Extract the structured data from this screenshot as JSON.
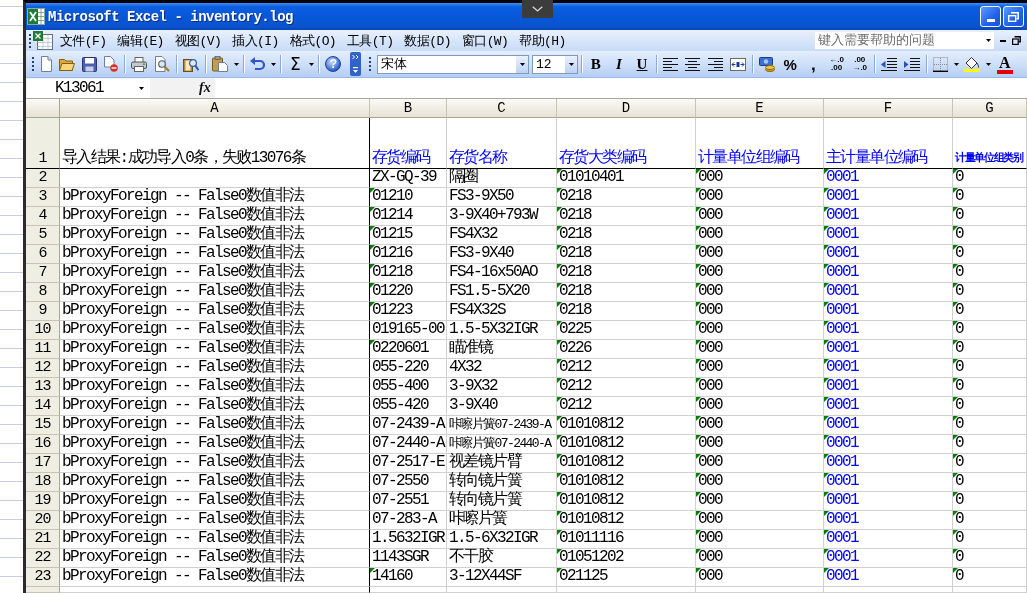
{
  "window": {
    "title": "Microsoft Excel - inventory.log"
  },
  "menu_bar": {
    "items": [
      "文件(F)",
      "编辑(E)",
      "视图(V)",
      "插入(I)",
      "格式(O)",
      "工具(T)",
      "数据(D)",
      "窗口(W)",
      "帮助(H)"
    ],
    "help_search": {
      "placeholder": "键入需要帮助的问题"
    }
  },
  "standard_toolbar": {
    "sum_button": "Σ",
    "help_button": "?"
  },
  "formatting_toolbar": {
    "font": "宋体",
    "font_size": "12",
    "style_buttons": [
      {
        "kind": "bold",
        "label": "B"
      },
      {
        "kind": "italic",
        "label": "I"
      },
      {
        "kind": "underline",
        "label": "U"
      }
    ],
    "percent_button": "%",
    "comma_button": ",",
    "increase_decimal": [
      "←.0",
      ".00"
    ],
    "decrease_decimal": [
      ".00",
      "→.0"
    ],
    "font_color_button": "A"
  },
  "formula_bar": {
    "name_box": "K13061",
    "function_button": "fx"
  },
  "sheet": {
    "columns": [
      "A",
      "B",
      "C",
      "D",
      "E",
      "F",
      "G"
    ],
    "rows": [
      {
        "number": "1",
        "cells": [
          {
            "text": "导入结果:成功导入0条，失败13076条",
            "error_mark": false
          },
          {
            "text": "存货编码",
            "error_mark": false,
            "color": "#0000ff"
          },
          {
            "text": "存货名称",
            "error_mark": false,
            "color": "#0000ff"
          },
          {
            "text": "存货大类编码",
            "error_mark": false,
            "color": "#0000ff"
          },
          {
            "text": "计量单位组编码",
            "error_mark": false,
            "color": "#0000ff"
          },
          {
            "text": "主计量单位编码",
            "error_mark": false,
            "color": "#0000ff"
          },
          {
            "text": "计量单位组类别",
            "error_mark": false,
            "color": "#0000ff"
          }
        ]
      },
      {
        "number": "2",
        "cells": [
          {
            "error_mark": false
          },
          {
            "text": "ZX-GQ-39",
            "error_mark": false
          },
          {
            "text": "隔圈",
            "error_mark": false
          },
          {
            "text": "01010401",
            "error_mark": true
          },
          {
            "text": "000",
            "error_mark": true
          },
          {
            "text": "0001",
            "error_mark": true,
            "color": "#0000ff"
          },
          {
            "text": "0",
            "error_mark": true
          }
        ]
      },
      {
        "number": "3",
        "cells": [
          {
            "text": "bProxyForeign -- False0数值非法",
            "error_mark": false
          },
          {
            "text": "01210",
            "error_mark": true
          },
          {
            "text": "FS3-9X50",
            "error_mark": false
          },
          {
            "text": "0218",
            "error_mark": true
          },
          {
            "text": "000",
            "error_mark": true
          },
          {
            "text": "0001",
            "error_mark": true,
            "color": "#0000ff"
          },
          {
            "text": "0",
            "error_mark": true
          }
        ]
      },
      {
        "number": "4",
        "cells": [
          {
            "text": "bProxyForeign -- False0数值非法",
            "error_mark": false
          },
          {
            "text": "01214",
            "error_mark": true
          },
          {
            "text": "3-9X40+793W",
            "error_mark": false
          },
          {
            "text": "0218",
            "error_mark": true
          },
          {
            "text": "000",
            "error_mark": true
          },
          {
            "text": "0001",
            "error_mark": true,
            "color": "#0000ff"
          },
          {
            "text": "0",
            "error_mark": true
          }
        ]
      },
      {
        "number": "5",
        "cells": [
          {
            "text": "bProxyForeign -- False0数值非法",
            "error_mark": false
          },
          {
            "text": "01215",
            "error_mark": true
          },
          {
            "text": "FS4X32",
            "error_mark": false
          },
          {
            "text": "0218",
            "error_mark": true
          },
          {
            "text": "000",
            "error_mark": true
          },
          {
            "text": "0001",
            "error_mark": true,
            "color": "#0000ff"
          },
          {
            "text": "0",
            "error_mark": true
          }
        ]
      },
      {
        "number": "6",
        "cells": [
          {
            "text": "bProxyForeign -- False0数值非法",
            "error_mark": false
          },
          {
            "text": "01216",
            "error_mark": true
          },
          {
            "text": "FS3-9X40",
            "error_mark": false
          },
          {
            "text": "0218",
            "error_mark": true
          },
          {
            "text": "000",
            "error_mark": true
          },
          {
            "text": "0001",
            "error_mark": true,
            "color": "#0000ff"
          },
          {
            "text": "0",
            "error_mark": true
          }
        ]
      },
      {
        "number": "7",
        "cells": [
          {
            "text": "bProxyForeign -- False0数值非法",
            "error_mark": false
          },
          {
            "text": "01218",
            "error_mark": true
          },
          {
            "text": "FS4-16x50AO",
            "error_mark": false
          },
          {
            "text": "0218",
            "error_mark": true
          },
          {
            "text": "000",
            "error_mark": true
          },
          {
            "text": "0001",
            "error_mark": true,
            "color": "#0000ff"
          },
          {
            "text": "0",
            "error_mark": true
          }
        ]
      },
      {
        "number": "8",
        "cells": [
          {
            "text": "bProxyForeign -- False0数值非法",
            "error_mark": false
          },
          {
            "text": "01220",
            "error_mark": true
          },
          {
            "text": "FS1.5-5X20",
            "error_mark": false
          },
          {
            "text": "0218",
            "error_mark": true
          },
          {
            "text": "000",
            "error_mark": true
          },
          {
            "text": "0001",
            "error_mark": true,
            "color": "#0000ff"
          },
          {
            "text": "0",
            "error_mark": true
          }
        ]
      },
      {
        "number": "9",
        "cells": [
          {
            "text": "bProxyForeign -- False0数值非法",
            "error_mark": false
          },
          {
            "text": "01223",
            "error_mark": true
          },
          {
            "text": "FS4X32S",
            "error_mark": false
          },
          {
            "text": "0218",
            "error_mark": true
          },
          {
            "text": "000",
            "error_mark": true
          },
          {
            "text": "0001",
            "error_mark": true,
            "color": "#0000ff"
          },
          {
            "text": "0",
            "error_mark": true
          }
        ]
      },
      {
        "number": "10",
        "cells": [
          {
            "text": "bProxyForeign -- False0数值非法",
            "error_mark": false
          },
          {
            "text": "019165-00",
            "error_mark": false
          },
          {
            "text": "1.5-5X32IGR",
            "error_mark": false
          },
          {
            "text": "0225",
            "error_mark": true
          },
          {
            "text": "000",
            "error_mark": true
          },
          {
            "text": "0001",
            "error_mark": true,
            "color": "#0000ff"
          },
          {
            "text": "0",
            "error_mark": true
          }
        ]
      },
      {
        "number": "11",
        "cells": [
          {
            "text": "bProxyForeign -- False0数值非法",
            "error_mark": false
          },
          {
            "text": "0220601",
            "error_mark": true
          },
          {
            "text": "瞄准镜",
            "error_mark": false
          },
          {
            "text": "0226",
            "error_mark": true
          },
          {
            "text": "000",
            "error_mark": true
          },
          {
            "text": "0001",
            "error_mark": true,
            "color": "#0000ff"
          },
          {
            "text": "0",
            "error_mark": true
          }
        ]
      },
      {
        "number": "12",
        "cells": [
          {
            "text": "bProxyForeign -- False0数值非法",
            "error_mark": false
          },
          {
            "text": "055-220",
            "error_mark": false
          },
          {
            "text": "4X32",
            "error_mark": false
          },
          {
            "text": "0212",
            "error_mark": true
          },
          {
            "text": "000",
            "error_mark": true
          },
          {
            "text": "0001",
            "error_mark": true,
            "color": "#0000ff"
          },
          {
            "text": "0",
            "error_mark": true
          }
        ]
      },
      {
        "number": "13",
        "cells": [
          {
            "text": "bProxyForeign -- False0数值非法",
            "error_mark": false
          },
          {
            "text": "055-400",
            "error_mark": false
          },
          {
            "text": "3-9X32",
            "error_mark": false
          },
          {
            "text": "0212",
            "error_mark": true
          },
          {
            "text": "000",
            "error_mark": true
          },
          {
            "text": "0001",
            "error_mark": true,
            "color": "#0000ff"
          },
          {
            "text": "0",
            "error_mark": true
          }
        ]
      },
      {
        "number": "14",
        "cells": [
          {
            "text": "bProxyForeign -- False0数值非法",
            "error_mark": false
          },
          {
            "text": "055-420",
            "error_mark": false
          },
          {
            "text": "3-9X40",
            "error_mark": false
          },
          {
            "text": "0212",
            "error_mark": true
          },
          {
            "text": "000",
            "error_mark": true
          },
          {
            "text": "0001",
            "error_mark": true,
            "color": "#0000ff"
          },
          {
            "text": "0",
            "error_mark": true
          }
        ]
      },
      {
        "number": "15",
        "cells": [
          {
            "text": "bProxyForeign -- False0数值非法",
            "error_mark": false
          },
          {
            "text": "07-2439-A",
            "error_mark": false
          },
          {
            "text": "咔嚓片簧07-2439-A",
            "error_mark": false
          },
          {
            "text": "01010812",
            "error_mark": true
          },
          {
            "text": "000",
            "error_mark": true
          },
          {
            "text": "0001",
            "error_mark": true,
            "color": "#0000ff"
          },
          {
            "text": "0",
            "error_mark": true
          }
        ]
      },
      {
        "number": "16",
        "cells": [
          {
            "text": "bProxyForeign -- False0数值非法",
            "error_mark": false
          },
          {
            "text": "07-2440-A",
            "error_mark": false
          },
          {
            "text": "咔嚓片簧07-2440-A",
            "error_mark": false
          },
          {
            "text": "01010812",
            "error_mark": true
          },
          {
            "text": "000",
            "error_mark": true
          },
          {
            "text": "0001",
            "error_mark": true,
            "color": "#0000ff"
          },
          {
            "text": "0",
            "error_mark": true
          }
        ]
      },
      {
        "number": "17",
        "cells": [
          {
            "text": "bProxyForeign -- False0数值非法",
            "error_mark": false
          },
          {
            "text": "07-2517-E",
            "error_mark": false
          },
          {
            "text": "视差镜片臂",
            "error_mark": false
          },
          {
            "text": "01010812",
            "error_mark": true
          },
          {
            "text": "000",
            "error_mark": true
          },
          {
            "text": "0001",
            "error_mark": true,
            "color": "#0000ff"
          },
          {
            "text": "0",
            "error_mark": true
          }
        ]
      },
      {
        "number": "18",
        "cells": [
          {
            "text": "bProxyForeign -- False0数值非法",
            "error_mark": false
          },
          {
            "text": "07-2550",
            "error_mark": false
          },
          {
            "text": "转向镜片簧",
            "error_mark": false
          },
          {
            "text": "01010812",
            "error_mark": true
          },
          {
            "text": "000",
            "error_mark": true
          },
          {
            "text": "0001",
            "error_mark": true,
            "color": "#0000ff"
          },
          {
            "text": "0",
            "error_mark": true
          }
        ]
      },
      {
        "number": "19",
        "cells": [
          {
            "text": "bProxyForeign -- False0数值非法",
            "error_mark": false
          },
          {
            "text": "07-2551",
            "error_mark": false
          },
          {
            "text": "转向镜片簧",
            "error_mark": false
          },
          {
            "text": "01010812",
            "error_mark": true
          },
          {
            "text": "000",
            "error_mark": true
          },
          {
            "text": "0001",
            "error_mark": true,
            "color": "#0000ff"
          },
          {
            "text": "0",
            "error_mark": true
          }
        ]
      },
      {
        "number": "20",
        "cells": [
          {
            "text": "bProxyForeign -- False0数值非法",
            "error_mark": false
          },
          {
            "text": "07-283-A",
            "error_mark": false
          },
          {
            "text": "咔嚓片簧",
            "error_mark": false
          },
          {
            "text": "01010812",
            "error_mark": true
          },
          {
            "text": "000",
            "error_mark": true
          },
          {
            "text": "0001",
            "error_mark": true,
            "color": "#0000ff"
          },
          {
            "text": "0",
            "error_mark": true
          }
        ]
      },
      {
        "number": "21",
        "cells": [
          {
            "text": "bProxyForeign -- False0数值非法",
            "error_mark": false
          },
          {
            "text": "1.5632IGR",
            "error_mark": false
          },
          {
            "text": "1.5-6X32IGR",
            "error_mark": false
          },
          {
            "text": "01011116",
            "error_mark": true
          },
          {
            "text": "000",
            "error_mark": true
          },
          {
            "text": "0001",
            "error_mark": true,
            "color": "#0000ff"
          },
          {
            "text": "0",
            "error_mark": true
          }
        ]
      },
      {
        "number": "22",
        "cells": [
          {
            "text": "bProxyForeign -- False0数值非法",
            "error_mark": false
          },
          {
            "text": "1143SGR",
            "error_mark": false
          },
          {
            "text": "不干胶",
            "error_mark": false
          },
          {
            "text": "01051202",
            "error_mark": true
          },
          {
            "text": "000",
            "error_mark": true
          },
          {
            "text": "0001",
            "error_mark": true,
            "color": "#0000ff"
          },
          {
            "text": "0",
            "error_mark": true
          }
        ]
      },
      {
        "number": "23",
        "cells": [
          {
            "text": "bProxyForeign -- False0数值非法",
            "error_mark": false
          },
          {
            "text": "14160",
            "error_mark": true
          },
          {
            "text": "3-12X44SF",
            "error_mark": false
          },
          {
            "text": "021125",
            "error_mark": true
          },
          {
            "text": "000",
            "error_mark": true
          },
          {
            "text": "0001",
            "error_mark": true,
            "color": "#0000ff"
          },
          {
            "text": "0",
            "error_mark": true
          }
        ]
      }
    ]
  }
}
